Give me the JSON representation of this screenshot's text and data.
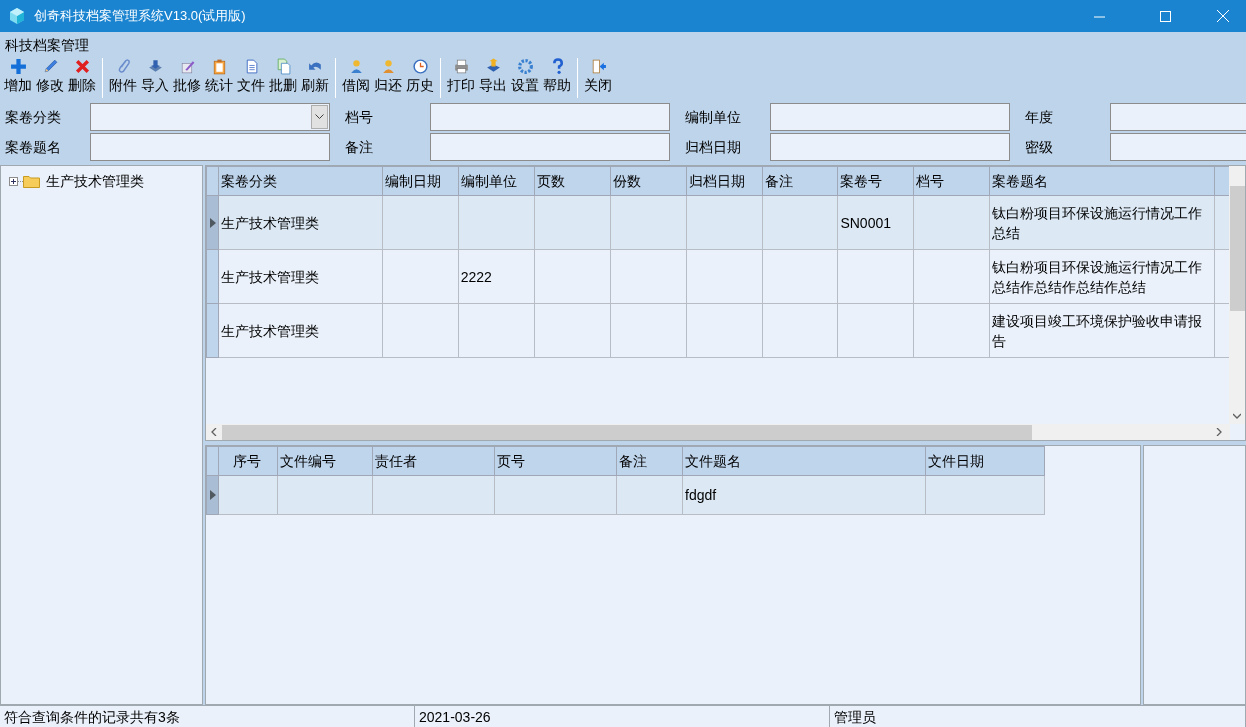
{
  "window": {
    "title": "创奇科技档案管理系统V13.0(试用版)"
  },
  "menu_label": "科技档案管理",
  "toolbar_groups": [
    [
      "增加",
      "修改",
      "删除"
    ],
    [
      "附件",
      "导入",
      "批修",
      "统计",
      "文件",
      "批删",
      "刷新"
    ],
    [
      "借阅",
      "归还",
      "历史"
    ],
    [
      "打印",
      "导出",
      "设置",
      "帮助"
    ],
    [
      "关闭"
    ]
  ],
  "filters": [
    [
      {
        "label": "案卷分类",
        "kind": "combo"
      },
      {
        "label": "档号",
        "kind": "text"
      },
      {
        "label": "编制单位",
        "kind": "text"
      },
      {
        "label": "年度",
        "kind": "text"
      }
    ],
    [
      {
        "label": "案卷题名",
        "kind": "text"
      },
      {
        "label": "备注",
        "kind": "text"
      },
      {
        "label": "归档日期",
        "kind": "text"
      },
      {
        "label": "密级",
        "kind": "text"
      }
    ]
  ],
  "tree": [
    {
      "label": "生产技术管理类",
      "expanded": false
    }
  ],
  "volumes_table": {
    "columns": [
      "案卷分类",
      "编制日期",
      "编制单位",
      "页数",
      "份数",
      "归档日期",
      "备注",
      "案卷号",
      "档号",
      "案卷题名"
    ],
    "rows": [
      {
        "selected": true,
        "cells": [
          "生产技术管理类",
          "",
          "",
          "",
          "",
          "",
          "",
          "SN0001",
          "",
          "钛白粉项目环保设施运行情况工作总结"
        ]
      },
      {
        "selected": false,
        "cells": [
          "生产技术管理类",
          "",
          "2222",
          "",
          "",
          "",
          "",
          "",
          "",
          "钛白粉项目环保设施运行情况工作总结作总结作总结作总结"
        ]
      },
      {
        "selected": false,
        "cells": [
          "生产技术管理类",
          "",
          "",
          "",
          "",
          "",
          "",
          "",
          "",
          "建设项目竣工环境保护验收申请报告"
        ]
      }
    ]
  },
  "files_table": {
    "columns": [
      "序号",
      "文件编号",
      "责任者",
      "页号",
      "备注",
      "文件题名",
      "文件日期"
    ],
    "rows": [
      {
        "selected": true,
        "cells": [
          "",
          "",
          "",
          "",
          "",
          "fdgdf",
          ""
        ]
      }
    ]
  },
  "status_bar": [
    "符合查询条件的记录共有3条",
    "2021-03-26",
    "管理员"
  ]
}
